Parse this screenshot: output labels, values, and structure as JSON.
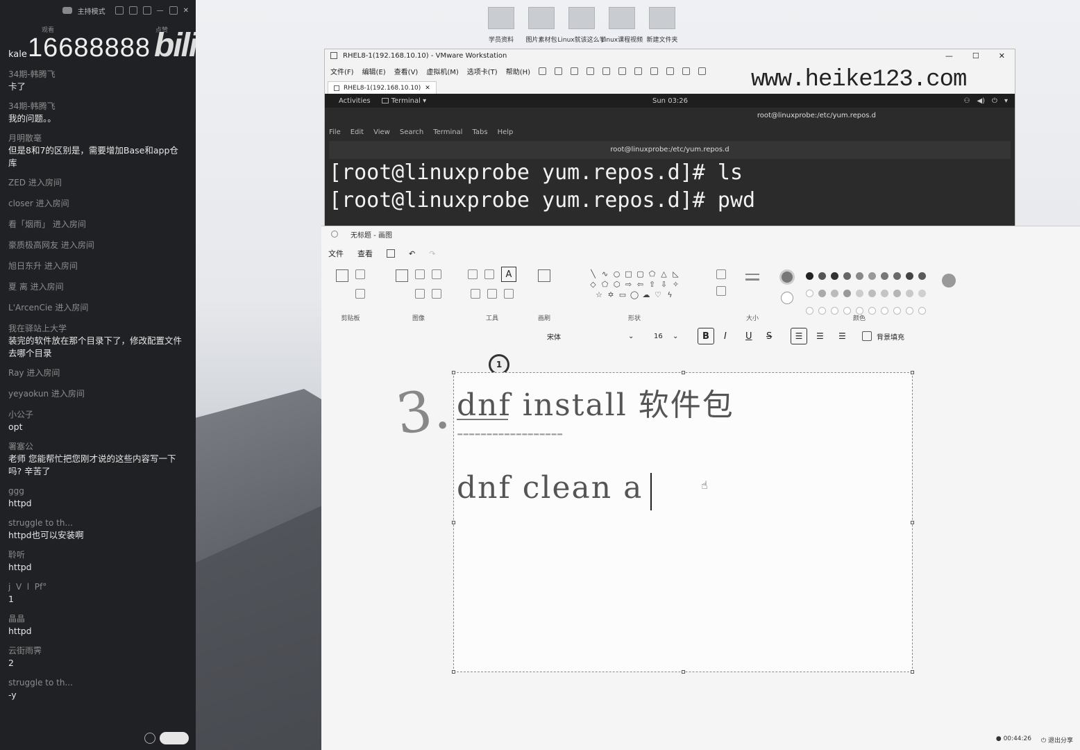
{
  "chat": {
    "topbar_title": "主持模式",
    "subheader": [
      "观看",
      "点赞"
    ],
    "watermark_number": "16688888",
    "watermark_logo": "bilibili",
    "messages": [
      {
        "user": "kale",
        "text": ""
      },
      {
        "user": "34期-韩腾飞",
        "text": "卡了"
      },
      {
        "user": "34期-韩腾飞",
        "text": "我的问题。。"
      },
      {
        "user": "月明散毫",
        "text": "但是8和7的区别是，需要增加Base和app仓库"
      }
    ],
    "enter_events": [
      "ZED 进入房间",
      "closer 进入房间",
      "看「烟雨」 进入房间",
      "豪质极高网友 进入房间",
      "旭日东升 进入房间",
      "夏 离 进入房间",
      "L'ArcenCie 进入房间"
    ],
    "messages2": [
      {
        "user": "我在驿站上大学",
        "text": "装完的软件放在那个目录下了，修改配置文件去哪个目录"
      }
    ],
    "enter_events2": [
      "Ray 进入房间",
      "yeyaokun 进入房间"
    ],
    "messages3": [
      {
        "user": "小公子",
        "text": "opt"
      },
      {
        "user": "署塞公",
        "text": "老师 您能帮忙把您刚才说的这些内容写一下吗? 辛苦了"
      },
      {
        "user": "ggg",
        "text": "httpd"
      },
      {
        "user": "struggle to th...",
        "text": "httpd也可以安装啊"
      },
      {
        "user": "聆听",
        "text": "httpd"
      },
      {
        "user": "j  V  l  Pf°",
        "text": "1"
      },
      {
        "user": "晶晶",
        "text": "httpd"
      },
      {
        "user": "云街雨霁",
        "text": "2"
      },
      {
        "user": "struggle to th...",
        "text": "-y"
      }
    ]
  },
  "desktop": {
    "icons": [
      "学员资料",
      "图片素材包",
      "Linux就该这么学",
      "Linux课程视频",
      "新建文件夹"
    ]
  },
  "vmware": {
    "title": "RHEL8-1(192.168.10.10) - VMware Workstation",
    "menu": [
      "文件(F)",
      "编辑(E)",
      "查看(V)",
      "虚拟机(M)",
      "选项卡(T)",
      "帮助(H)"
    ],
    "tab": "RHEL8-1(192.168.10.10)",
    "gnome": {
      "activities": "Activities",
      "app": "Terminal ▾",
      "clock": "Sun 03:26"
    },
    "term_header": "root@linuxprobe:/etc/yum.repos.d",
    "term_menu": [
      "File",
      "Edit",
      "View",
      "Search",
      "Terminal",
      "Tabs",
      "Help"
    ],
    "term_tab_title": "root@linuxprobe:/etc/yum.repos.d",
    "lines": [
      "[root@linuxprobe yum.repos.d]# ls",
      "[root@linuxprobe yum.repos.d]# pwd"
    ]
  },
  "url_watermark": "www.heike123.com",
  "paint": {
    "title": "无标题 - 画图",
    "menu": [
      "文件",
      "查看"
    ],
    "groups": [
      "剪贴板",
      "图像",
      "工具",
      "画刷",
      "形状",
      "大小",
      "颜色"
    ],
    "font_name": "宋体",
    "font_size": "16",
    "fill_bg_label": "背景填充",
    "step_badge": "1",
    "annotation_3": "3.",
    "canvas_lines": [
      "dnf install 软件包",
      "------------------",
      "dnf clean a"
    ],
    "status_time": "00:44:26",
    "status_exit": "退出分享"
  }
}
